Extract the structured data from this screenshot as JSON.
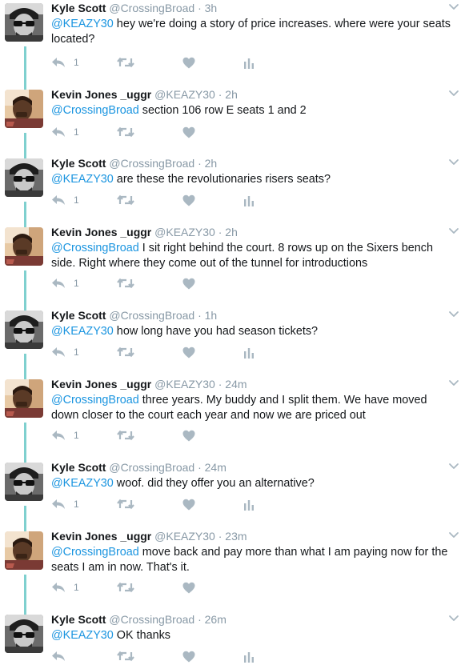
{
  "colors": {
    "name": "#14171a",
    "muted": "#8899a6",
    "link": "#1b95e0",
    "thread_line": "#7fd0cf",
    "icons": "#aab8c2"
  },
  "tweets": [
    {
      "name": "Kyle Scott",
      "handle": "@CrossingBroad",
      "dot": "·",
      "time": "3h",
      "mention": "@KEAZY30",
      "text": " hey we're doing a story of price increases. where were your seats located?",
      "reply_count": "1",
      "analytics": true,
      "avatar": "kyle"
    },
    {
      "name": "Kevin Jones _uggr",
      "handle": "@KEAZY30",
      "dot": "·",
      "time": "2h",
      "mention": "@CrossingBroad",
      "text": " section 106 row E seats 1 and 2",
      "reply_count": "1",
      "analytics": false,
      "avatar": "kevin"
    },
    {
      "name": "Kyle Scott",
      "handle": "@CrossingBroad",
      "dot": "·",
      "time": "2h",
      "mention": "@KEAZY30",
      "text": " are these the revolutionaries risers seats?",
      "reply_count": "1",
      "analytics": true,
      "avatar": "kyle"
    },
    {
      "name": "Kevin Jones _uggr",
      "handle": "@KEAZY30",
      "dot": "·",
      "time": "2h",
      "mention": "@CrossingBroad",
      "text": " I sit right behind the court. 8 rows up on the Sixers bench side. Right where they come out of the tunnel for introductions",
      "reply_count": "1",
      "analytics": false,
      "avatar": "kevin"
    },
    {
      "name": "Kyle Scott",
      "handle": "@CrossingBroad",
      "dot": "·",
      "time": "1h",
      "mention": "@KEAZY30",
      "text": " how long have you had season tickets?",
      "reply_count": "1",
      "analytics": true,
      "avatar": "kyle"
    },
    {
      "name": "Kevin Jones _uggr",
      "handle": "@KEAZY30",
      "dot": "·",
      "time": "24m",
      "mention": "@CrossingBroad",
      "text": " three years. My buddy and I split them. We have moved down closer to the court each year and now we are priced out",
      "reply_count": "1",
      "analytics": false,
      "avatar": "kevin"
    },
    {
      "name": "Kyle Scott",
      "handle": "@CrossingBroad",
      "dot": "·",
      "time": "24m",
      "mention": "@KEAZY30",
      "text": " woof. did they offer you an alternative?",
      "reply_count": "1",
      "analytics": true,
      "avatar": "kyle"
    },
    {
      "name": "Kevin Jones _uggr",
      "handle": "@KEAZY30",
      "dot": "·",
      "time": "23m",
      "mention": "@CrossingBroad",
      "text": " move back and pay more than what I am paying now for the seats I am in now. That's it.",
      "reply_count": "1",
      "analytics": false,
      "avatar": "kevin"
    },
    {
      "name": "Kyle Scott",
      "handle": "@CrossingBroad",
      "dot": "·",
      "time": "26m",
      "mention": "@KEAZY30",
      "text": " OK thanks",
      "reply_count": "",
      "analytics": true,
      "avatar": "kyle"
    }
  ]
}
